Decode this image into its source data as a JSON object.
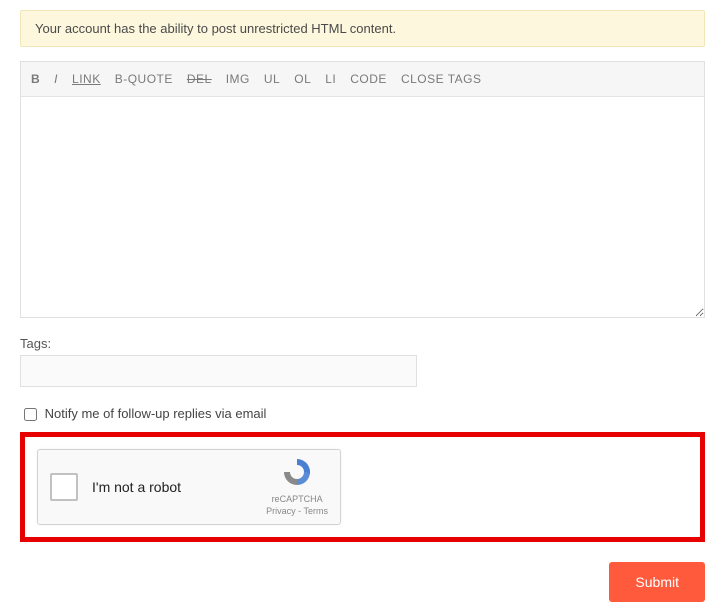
{
  "notice": "Your account has the ability to post unrestricted HTML content.",
  "toolbar": {
    "bold": "B",
    "italic": "I",
    "link": "LINK",
    "bquote": "B-QUOTE",
    "del": "DEL",
    "img": "IMG",
    "ul": "UL",
    "ol": "OL",
    "li": "LI",
    "code": "CODE",
    "close": "CLOSE TAGS"
  },
  "content": "",
  "tags": {
    "label": "Tags:",
    "value": ""
  },
  "notify_label": "Notify me of follow-up replies via email",
  "recaptcha": {
    "label": "I'm not a robot",
    "brand": "reCAPTCHA",
    "privacy": "Privacy",
    "sep": " - ",
    "terms": "Terms"
  },
  "submit": "Submit"
}
